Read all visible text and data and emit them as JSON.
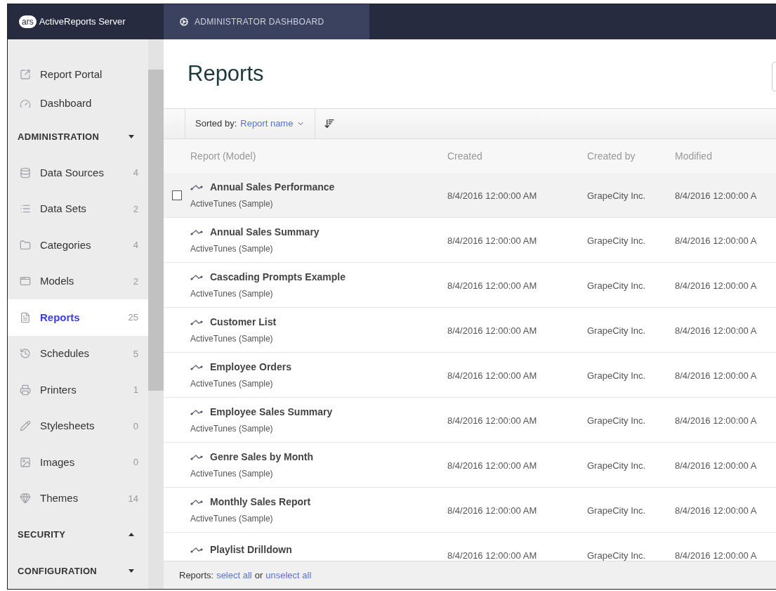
{
  "header": {
    "logo_badge": "ars",
    "product": "ActiveReports Server",
    "tab": {
      "label": "ADMINISTRATOR DASHBOARD",
      "selected": true
    }
  },
  "sidebar": {
    "items": [
      {
        "kind": "link",
        "label": "Report Portal",
        "selected": false
      },
      {
        "kind": "link",
        "label": "Dashboard",
        "selected": false
      },
      {
        "kind": "section",
        "label": "ADMINISTRATION",
        "children": [
          {
            "label": "Data Sources",
            "count": "4",
            "selected": false
          },
          {
            "label": "Data Sets",
            "count": "2",
            "selected": false
          },
          {
            "label": "Categories",
            "count": "4",
            "selected": false
          },
          {
            "label": "Models",
            "count": "2",
            "selected": false
          },
          {
            "label": "Reports",
            "count": "25",
            "selected": true
          },
          {
            "label": "Schedules",
            "count": "5",
            "selected": false
          },
          {
            "label": "Printers",
            "count": "1",
            "selected": false
          },
          {
            "label": "Stylesheets",
            "count": "0",
            "selected": false
          },
          {
            "label": "Images",
            "count": "0",
            "selected": false
          },
          {
            "label": "Themes",
            "count": "14",
            "selected": false
          }
        ]
      },
      {
        "kind": "section",
        "label": "SECURITY"
      },
      {
        "kind": "section",
        "label": "CONFIGURATION"
      }
    ]
  },
  "page": {
    "title": "Reports"
  },
  "toolbar": {
    "sort_label": "Sorted by:",
    "sort_value": "Report name"
  },
  "table": {
    "columns": [
      "Report (Model)",
      "Created",
      "Created by",
      "Modified"
    ],
    "rows": [
      {
        "name": "Annual Sales Performance",
        "model": "ActiveTunes (Sample)",
        "created": "8/4/2016 12:00:00 AM",
        "created_by": "GrapeCity Inc.",
        "modified": "8/4/2016 12:00:00 A",
        "highlighted": true
      },
      {
        "name": "Annual Sales Summary",
        "model": "ActiveTunes (Sample)",
        "created": "8/4/2016 12:00:00 AM",
        "created_by": "GrapeCity Inc.",
        "modified": "8/4/2016 12:00:00 A",
        "highlighted": false
      },
      {
        "name": "Cascading Prompts Example",
        "model": "ActiveTunes (Sample)",
        "created": "8/4/2016 12:00:00 AM",
        "created_by": "GrapeCity Inc.",
        "modified": "8/4/2016 12:00:00 A",
        "highlighted": false
      },
      {
        "name": "Customer List",
        "model": "ActiveTunes (Sample)",
        "created": "8/4/2016 12:00:00 AM",
        "created_by": "GrapeCity Inc.",
        "modified": "8/4/2016 12:00:00 A",
        "highlighted": false
      },
      {
        "name": "Employee Orders",
        "model": "ActiveTunes (Sample)",
        "created": "8/4/2016 12:00:00 AM",
        "created_by": "GrapeCity Inc.",
        "modified": "8/4/2016 12:00:00 A",
        "highlighted": false
      },
      {
        "name": "Employee Sales Summary",
        "model": "ActiveTunes (Sample)",
        "created": "8/4/2016 12:00:00 AM",
        "created_by": "GrapeCity Inc.",
        "modified": "8/4/2016 12:00:00 A",
        "highlighted": false
      },
      {
        "name": "Genre Sales by Month",
        "model": "ActiveTunes (Sample)",
        "created": "8/4/2016 12:00:00 AM",
        "created_by": "GrapeCity Inc.",
        "modified": "8/4/2016 12:00:00 A",
        "highlighted": false
      },
      {
        "name": "Monthly Sales Report",
        "model": "ActiveTunes (Sample)",
        "created": "8/4/2016 12:00:00 AM",
        "created_by": "GrapeCity Inc.",
        "modified": "8/4/2016 12:00:00 A",
        "highlighted": false
      },
      {
        "name": "Playlist Drilldown",
        "created": "8/4/2016 12:00:00 AM",
        "created_by": "GrapeCity Inc.",
        "modified": "8/4/2016 12:00:00 A",
        "highlighted": false
      }
    ]
  },
  "footer": {
    "label": "Reports:",
    "select_all": "select all",
    "connector": "or",
    "unselect_all": "unselect all"
  }
}
